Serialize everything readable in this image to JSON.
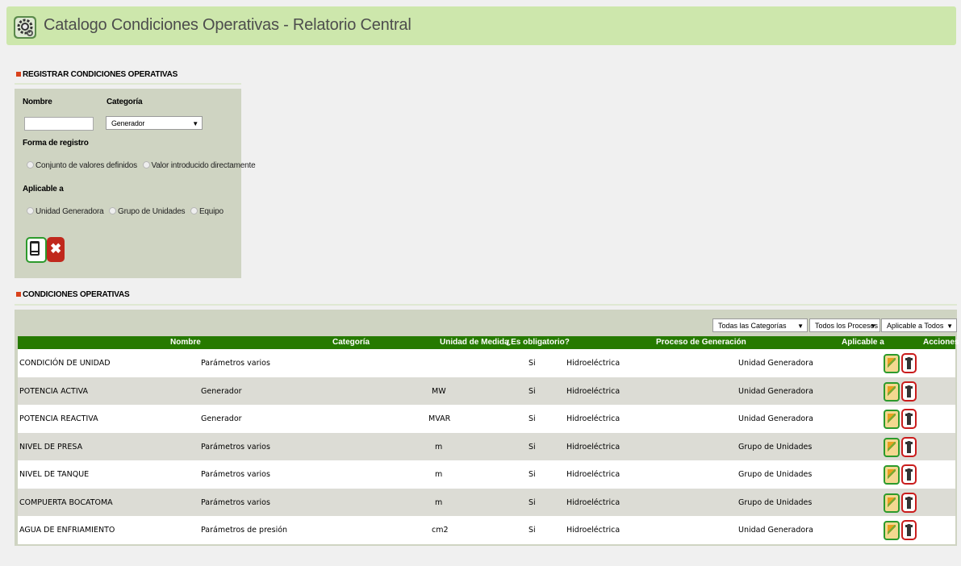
{
  "header": {
    "title": "Catalogo Condiciones Operativas - Relatorio Central",
    "icon": "gear-icon"
  },
  "register": {
    "heading": "REGISTRAR CONDICIONES OPERATIVAS",
    "nombre_label": "Nombre",
    "nombre_value": "",
    "categoria_label": "Categoría",
    "categoria_selected": "Generador",
    "forma_label": "Forma de registro",
    "forma_options": [
      "Conjunto de valores definidos",
      "Valor introducido directamente"
    ],
    "aplicable_label": "Aplicable a",
    "aplicable_options": [
      "Unidad Generadora",
      "Grupo de Unidades",
      "Equipo"
    ]
  },
  "list": {
    "heading": "CONDICIONES OPERATIVAS",
    "filters": {
      "categorias": "Todas las Categorías",
      "procesos": "Todos los Procesos",
      "aplicable": "Aplicable a Todos"
    },
    "columns": {
      "nombre": "Nombre",
      "categoria": "Categoría",
      "unidad": "Unidad de Medida",
      "obligatorio": "¿Es obligatorio?",
      "proceso": "Proceso de Generación",
      "aplicable": "Aplicable a",
      "acciones": "Acciones"
    },
    "rows": [
      {
        "nombre": "CONDICIÓN DE UNIDAD",
        "categoria": "Parámetros varios",
        "unidad": "",
        "obligatorio": "Si",
        "proceso": "Hidroeléctrica",
        "aplicable": "Unidad Generadora"
      },
      {
        "nombre": "POTENCIA ACTIVA",
        "categoria": "Generador",
        "unidad": "MW",
        "obligatorio": "Si",
        "proceso": "Hidroeléctrica",
        "aplicable": "Unidad Generadora"
      },
      {
        "nombre": "POTENCIA REACTIVA",
        "categoria": "Generador",
        "unidad": "MVAR",
        "obligatorio": "Si",
        "proceso": "Hidroeléctrica",
        "aplicable": "Unidad Generadora"
      },
      {
        "nombre": "NIVEL DE PRESA",
        "categoria": "Parámetros varios",
        "unidad": "m",
        "obligatorio": "Si",
        "proceso": "Hidroeléctrica",
        "aplicable": "Grupo de Unidades"
      },
      {
        "nombre": "NIVEL DE TANQUE",
        "categoria": "Parámetros varios",
        "unidad": "m",
        "obligatorio": "Si",
        "proceso": "Hidroeléctrica",
        "aplicable": "Grupo de Unidades"
      },
      {
        "nombre": "COMPUERTA BOCATOMA",
        "categoria": "Parámetros varios",
        "unidad": "m",
        "obligatorio": "Si",
        "proceso": "Hidroeléctrica",
        "aplicable": "Grupo de Unidades"
      },
      {
        "nombre": "AGUA DE ENFRIAMIENTO",
        "categoria": "Parámetros de presión",
        "unidad": "cm2",
        "obligatorio": "Si",
        "proceso": "Hidroeléctrica",
        "aplicable": "Unidad Generadora"
      }
    ]
  },
  "colors": {
    "header_bg": "#cde7ac",
    "table_header_bg": "#267a00",
    "panel_bg": "#cfd4c2",
    "accent_red": "#d9421c"
  }
}
